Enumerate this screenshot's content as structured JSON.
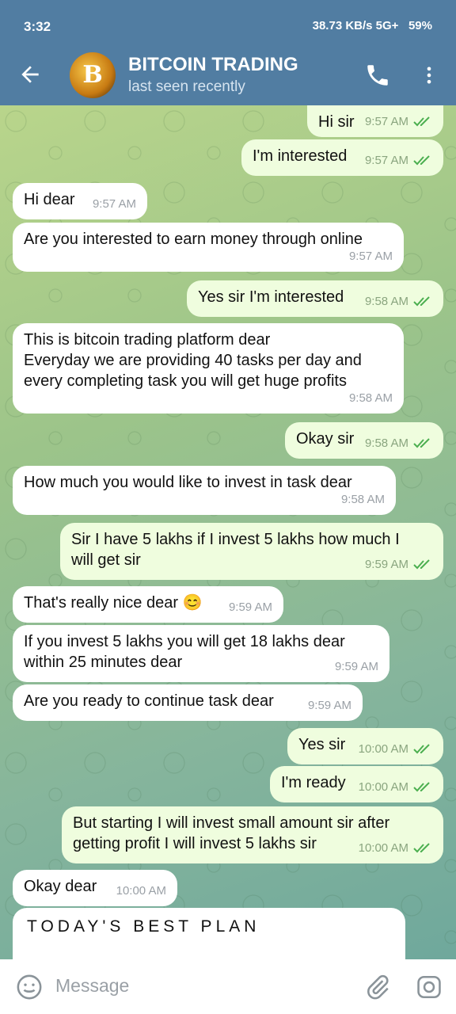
{
  "status_bar": {
    "time": "3:32",
    "indicators": "38.73 KB/s 5G+",
    "battery": "59%"
  },
  "header": {
    "title": "BITCOIN TRADING",
    "subtitle": "last seen recently",
    "avatar_letter": "B"
  },
  "messages": [
    {
      "dir": "out",
      "text": "Hi sir",
      "time": "9:57 AM"
    },
    {
      "dir": "out",
      "text": "I'm interested",
      "time": "9:57 AM"
    },
    {
      "dir": "in",
      "text": "Hi dear",
      "time": "9:57 AM"
    },
    {
      "dir": "in",
      "text": "Are you interested to earn money through online",
      "time": "9:57 AM"
    },
    {
      "dir": "out",
      "text": "Yes sir I'm interested",
      "time": "9:58 AM"
    },
    {
      "dir": "in",
      "text": "This is bitcoin trading platform dear\nEveryday we are providing 40 tasks per day and\nevery completing task you will get huge profits",
      "time": "9:58 AM"
    },
    {
      "dir": "out",
      "text": "Okay sir",
      "time": "9:58 AM"
    },
    {
      "dir": "in",
      "text": "How much you would like to invest in task dear",
      "time": "9:58 AM"
    },
    {
      "dir": "out",
      "text": "Sir I have 5 lakhs if I invest 5 lakhs how much I\nwill get sir",
      "time": "9:59 AM"
    },
    {
      "dir": "in",
      "text": "That's really nice dear 😊",
      "time": "9:59 AM"
    },
    {
      "dir": "in",
      "text": "If you invest 5 lakhs you will get 18 lakhs dear\nwithin 25 minutes dear",
      "time": "9:59 AM"
    },
    {
      "dir": "in",
      "text": "Are you ready to continue task dear",
      "time": "9:59 AM"
    },
    {
      "dir": "out",
      "text": "Yes sir",
      "time": "10:00 AM"
    },
    {
      "dir": "out",
      "text": "I'm ready",
      "time": "10:00 AM"
    },
    {
      "dir": "out",
      "text": "But starting I will invest small amount sir after\ngetting profit I will invest 5 lakhs sir",
      "time": "10:00 AM"
    },
    {
      "dir": "in",
      "text": "Okay dear",
      "time": "10:00 AM"
    }
  ],
  "pinned_text": "TODAY'S BEST PLAN",
  "input": {
    "placeholder": "Message"
  },
  "colors": {
    "header": "#517da2",
    "outgoing_bubble": "#effdde",
    "incoming_bubble": "#ffffff"
  },
  "icons": [
    "back-arrow-icon",
    "phone-icon",
    "more-vert-icon",
    "emoji-icon",
    "attach-icon",
    "camera-icon",
    "double-check-icon"
  ]
}
